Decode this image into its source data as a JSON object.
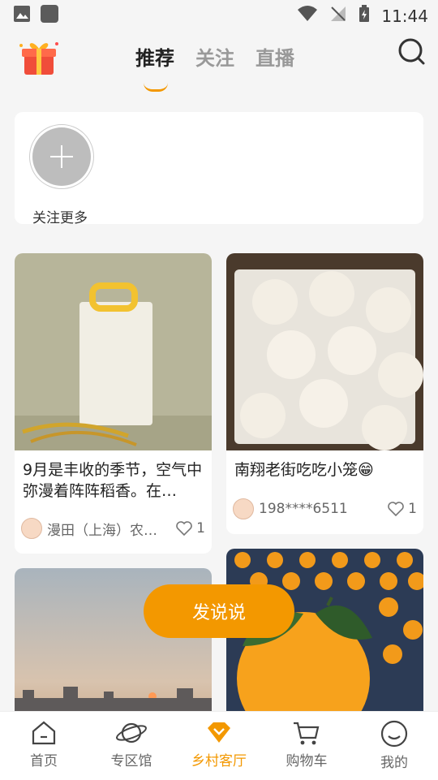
{
  "status_bar": {
    "time": "11:44"
  },
  "header": {
    "tabs": [
      {
        "label": "推荐"
      },
      {
        "label": "关注"
      },
      {
        "label": "直播"
      }
    ]
  },
  "follow": {
    "label": "关注更多"
  },
  "posts": [
    {
      "title": "9月是丰收的季节，空气中弥漫着阵阵稻香。在…",
      "author": "漫田（上海）农…",
      "likes": "1"
    },
    {
      "title": "南翔老街吃吃小笼😁",
      "author": "198****6511",
      "likes": "1"
    }
  ],
  "post_button": "发说说",
  "bottom_nav": [
    {
      "label": "首页"
    },
    {
      "label": "专区馆"
    },
    {
      "label": "乡村客厅"
    },
    {
      "label": "购物车"
    },
    {
      "label": "我的"
    }
  ],
  "colors": {
    "accent": "#f39800"
  }
}
